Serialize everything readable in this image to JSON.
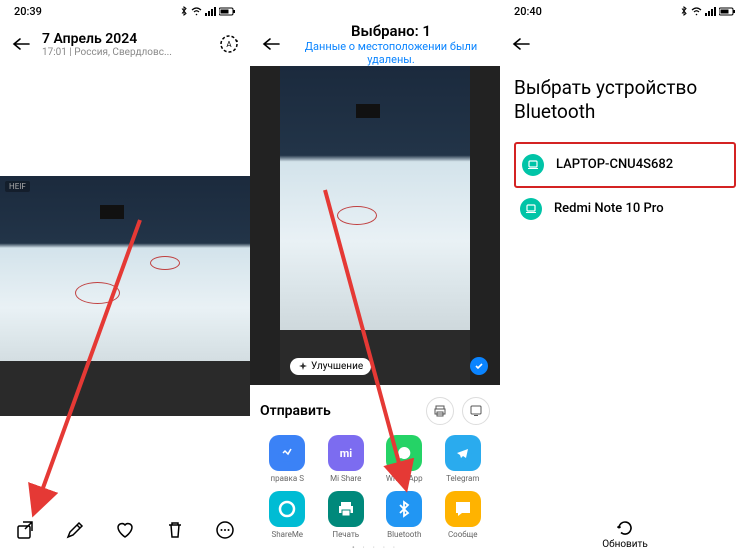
{
  "p1": {
    "time": "20:39",
    "date": "7 Апрель 2024",
    "subtitle": "17:01 | Россия, Свердловс...",
    "heif": "HEIF"
  },
  "p2": {
    "title": "Выбрано: 1",
    "location_deleted": "Данные о местоположении были удалены.",
    "enhance": "Улучшение",
    "send": "Отправить",
    "apps": [
      {
        "label": "правка  S",
        "color": "#3b82f6",
        "type": "s"
      },
      {
        "label": "Mi Share",
        "color": "#7c6cf0",
        "type": "mi"
      },
      {
        "label": "WhatsApp",
        "color": "#25d366",
        "type": "wa"
      },
      {
        "label": "Telegram",
        "color": "#2aabee",
        "type": "tg"
      },
      {
        "label": "ShareMe",
        "color": "#00bcd4",
        "type": "sm"
      },
      {
        "label": "Печать",
        "color": "#00897b",
        "type": "pr"
      },
      {
        "label": "Bluetooth",
        "color": "#2196f3",
        "type": "bt"
      },
      {
        "label": "Сообще",
        "color": "#ffb300",
        "type": "ms"
      }
    ]
  },
  "p3": {
    "time": "20:40",
    "title": "Выбрать устройство Bluetooth",
    "devices": [
      {
        "name": "LAPTOP-CNU4S682",
        "hl": true,
        "color": "#00c4a7"
      },
      {
        "name": "Redmi Note 10 Pro",
        "hl": false,
        "color": "#00c4a7"
      }
    ],
    "refresh": "Обновить"
  }
}
